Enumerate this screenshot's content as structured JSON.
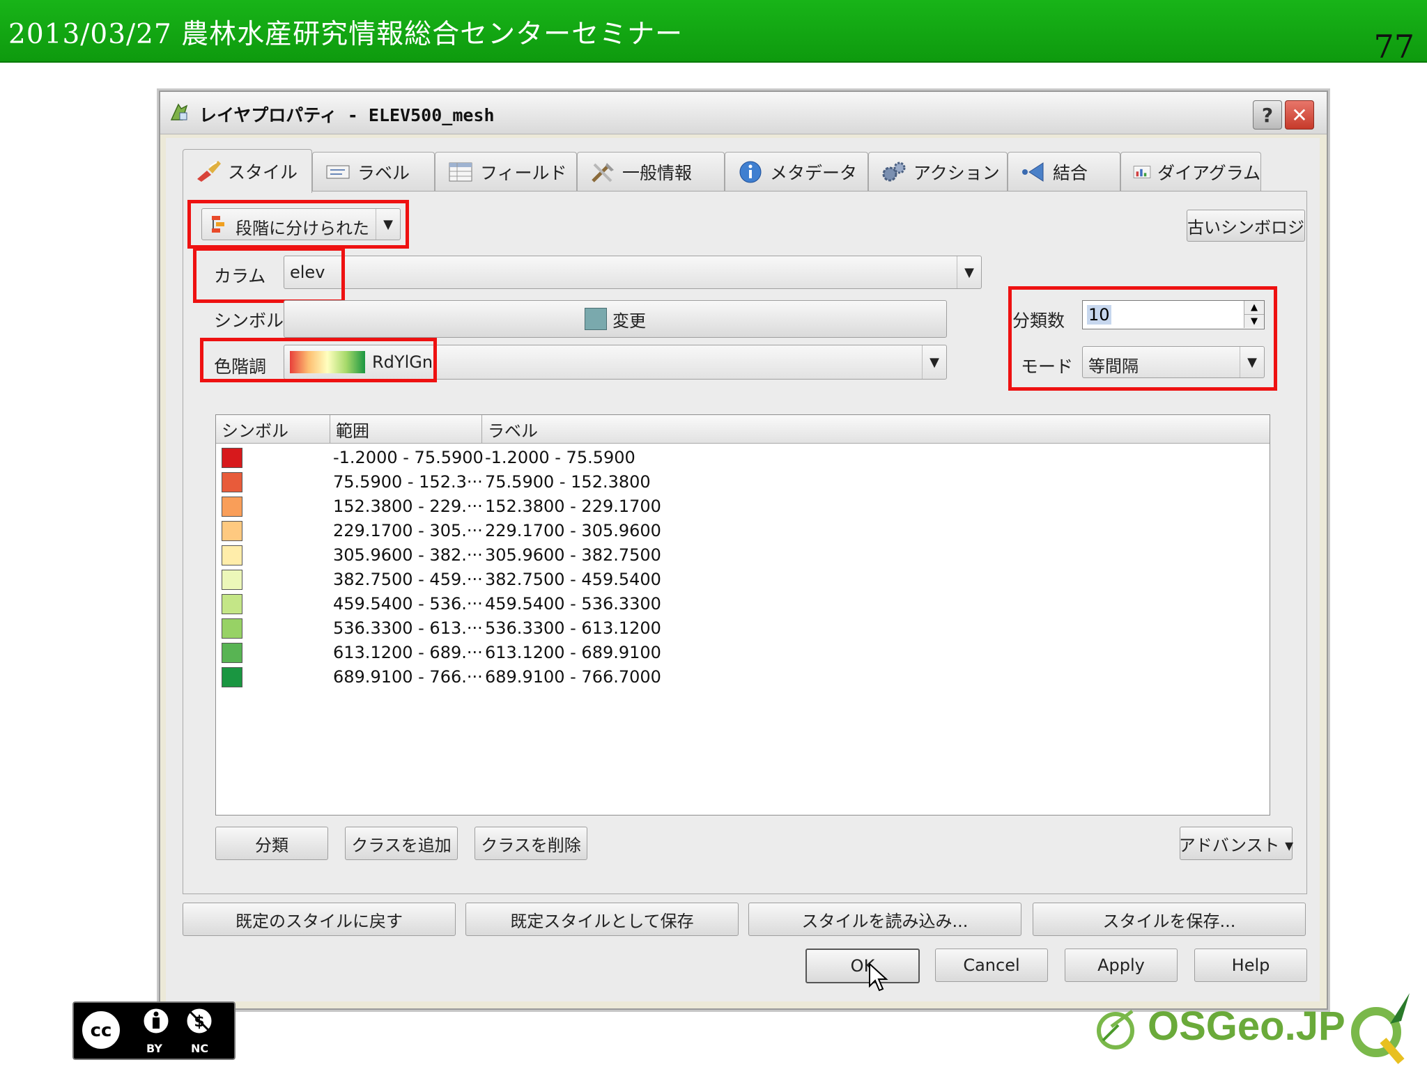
{
  "slide": {
    "header_title": "2013/03/27 農林水産研究情報総合センターセミナー",
    "page_number": "77",
    "header_color": "#10a810"
  },
  "window": {
    "title": "レイヤプロパティ - ELEV500_mesh",
    "help_label": "?",
    "close_label": "✕"
  },
  "tabs": [
    {
      "label": "スタイル",
      "icon": "brush-icon",
      "active": true
    },
    {
      "label": "ラベル",
      "icon": "label-icon"
    },
    {
      "label": "フィールド",
      "icon": "table-icon"
    },
    {
      "label": "一般情報",
      "icon": "tools-icon"
    },
    {
      "label": "メタデータ",
      "icon": "info-icon"
    },
    {
      "label": "アクション",
      "icon": "gears-icon"
    },
    {
      "label": "結合",
      "icon": "join-icon"
    },
    {
      "label": "ダイアグラム",
      "icon": "diagram-icon"
    }
  ],
  "style": {
    "renderer": "段階に分けられた",
    "old_symbology": "古いシンボロジ",
    "column_label": "カラム",
    "column_value": "elev",
    "symbol_label": "シンボル",
    "symbol_button": "変更",
    "ramp_label": "色階調",
    "ramp_value": "RdYlGn",
    "classes_label": "分類数",
    "classes_value": "10",
    "mode_label": "モード",
    "mode_value": "等間隔",
    "highlight_color": "#ee1111"
  },
  "table": {
    "headers": [
      "シンボル",
      "範囲",
      "ラベル"
    ],
    "rows": [
      {
        "color": "#d7191c",
        "range": "-1.2000 - 75.5900",
        "label": "-1.2000 - 75.5900"
      },
      {
        "color": "#e85b3a",
        "range": "75.5900 - 152.3···",
        "label": "75.5900 - 152.3800"
      },
      {
        "color": "#f99e59",
        "range": "152.3800 - 229.···",
        "label": "152.3800 - 229.1700"
      },
      {
        "color": "#fec980",
        "range": "229.1700 - 305.···",
        "label": "229.1700 - 305.9600"
      },
      {
        "color": "#ffedaa",
        "range": "305.9600 - 382.···",
        "label": "305.9600 - 382.7500"
      },
      {
        "color": "#ecf7b9",
        "range": "382.7500 - 459.···",
        "label": "382.7500 - 459.5400"
      },
      {
        "color": "#c4e687",
        "range": "459.5400 - 536.···",
        "label": "459.5400 - 536.3300"
      },
      {
        "color": "#97d265",
        "range": "536.3300 - 613.···",
        "label": "536.3300 - 613.1200"
      },
      {
        "color": "#58b453",
        "range": "613.1200 - 689.···",
        "label": "613.1200 - 689.9100"
      },
      {
        "color": "#1a9641",
        "range": "689.9100 - 766.···",
        "label": "689.9100 - 766.7000"
      }
    ]
  },
  "buttons": {
    "classify": "分類",
    "add_class": "クラスを追加",
    "delete_class": "クラスを削除",
    "advanced": "アドバンスト ▾",
    "restore_default": "既定のスタイルに戻す",
    "save_default": "既定スタイルとして保存",
    "load_style": "スタイルを読み込み...",
    "save_style": "スタイルを保存...",
    "ok": "OK",
    "cancel": "Cancel",
    "apply": "Apply",
    "help": "Help"
  },
  "footer": {
    "cc_by": "BY",
    "cc_nc": "NC",
    "osgeo_text": "OSGeo.JP"
  }
}
